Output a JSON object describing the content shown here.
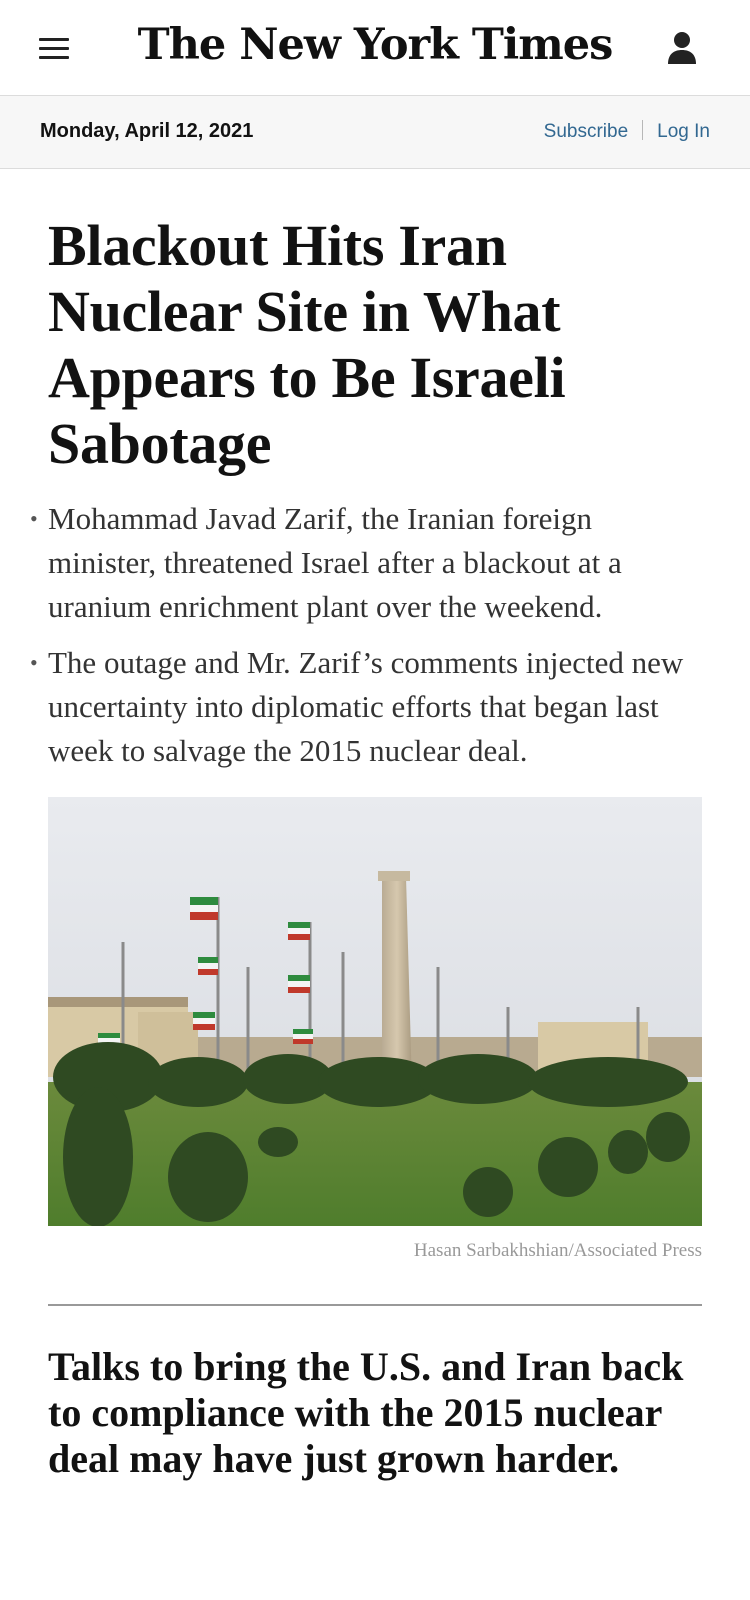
{
  "masthead": {
    "title": "The New York Times"
  },
  "datebar": {
    "date": "Monday, April 12, 2021",
    "subscribe": "Subscribe",
    "login": "Log In"
  },
  "article": {
    "headline": "Blackout Hits Iran Nuclear Site in What Appears to Be Israeli Sabotage",
    "summary": [
      "Mohammad Javad Zarif, the Iranian foreign minister, threatened Israel after a blackout at a uranium enrichment plant over the weekend.",
      "The outage and Mr. Zarif’s comments injected new uncertainty into diplomatic efforts that began last week to salvage the 2015 nuclear deal."
    ],
    "photo_credit": "Hasan Sarbakhshian/Associated Press",
    "subhead": "Talks to bring the U.S. and Iran back to compliance with the 2015 nuclear deal may have just grown harder."
  },
  "colors": {
    "link": "#326891",
    "datebar_bg": "#f7f7f7"
  },
  "icons": {
    "menu": "hamburger-icon",
    "account": "user-icon"
  }
}
